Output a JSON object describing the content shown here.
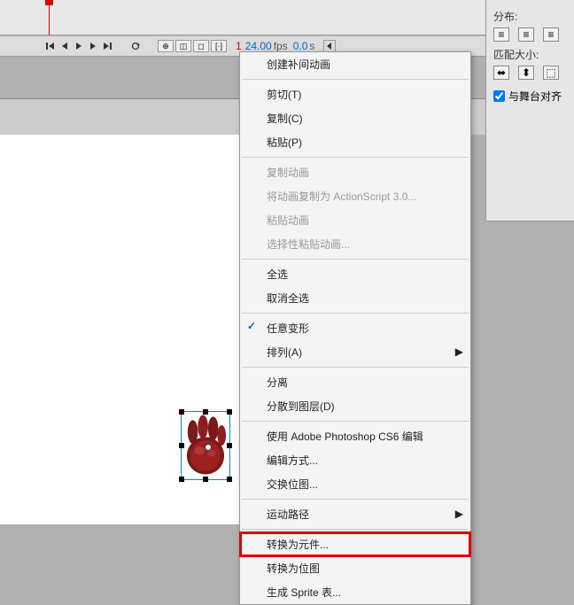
{
  "playback": {
    "frame": "1",
    "fps_value": "24.00",
    "fps_label": "fps",
    "time_value": "0.0",
    "time_label": "s"
  },
  "right_panel": {
    "distribute_label": "分布:",
    "match_size_label": "匹配大小:",
    "align_stage_label": "与舞台对齐"
  },
  "menu": {
    "create_tween": "创建补间动画",
    "cut": "剪切(T)",
    "copy": "复制(C)",
    "paste": "粘贴(P)",
    "copy_motion": "复制动画",
    "copy_motion_as": "将动画复制为 ActionScript 3.0...",
    "paste_motion": "粘贴动画",
    "paste_motion_special": "选择性粘贴动画...",
    "select_all": "全选",
    "deselect_all": "取消全选",
    "free_transform": "任意变形",
    "arrange": "排列(A)",
    "break_apart": "分离",
    "distribute_to_layers": "分散到图层(D)",
    "edit_photoshop": "使用 Adobe Photoshop CS6 编辑",
    "edit_with": "编辑方式...",
    "swap_bitmap": "交换位图...",
    "motion_path": "运动路径",
    "convert_to_symbol": "转换为元件...",
    "convert_to_bitmap": "转换为位图",
    "generate_sprite": "生成 Sprite 表..."
  }
}
